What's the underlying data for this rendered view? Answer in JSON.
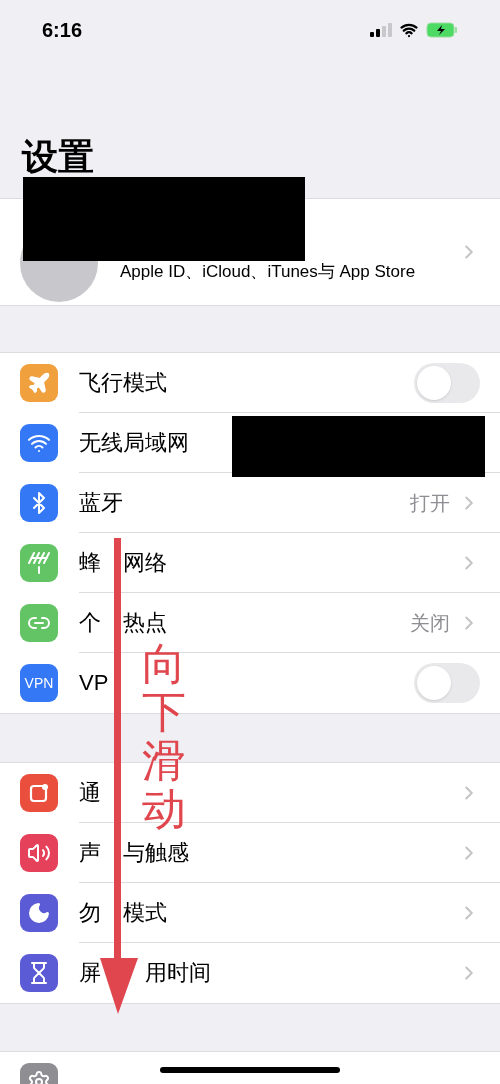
{
  "status_bar": {
    "time": "6:16"
  },
  "title": "设置",
  "profile": {
    "subtitle": "Apple ID、iCloud、iTunes与 App Store",
    "redacted": true
  },
  "groups": [
    {
      "rows": [
        {
          "kind": "toggle",
          "label_parts": [
            "飞行模式"
          ],
          "color": "#f0a03c",
          "on": false
        },
        {
          "kind": "link",
          "label_parts": [
            "无线局域网"
          ],
          "color": "#3478f6",
          "redacted": true
        },
        {
          "kind": "link",
          "label_parts": [
            "蓝牙"
          ],
          "color": "#3478f6",
          "detail": "打开"
        },
        {
          "kind": "link",
          "label_parts": [
            "蜂",
            "网络"
          ],
          "color": "#62c465"
        },
        {
          "kind": "link",
          "label_parts": [
            "个",
            "热点"
          ],
          "color": "#62c465",
          "detail": "关闭"
        },
        {
          "kind": "toggle",
          "label_parts": [
            "VP"
          ],
          "color": "#3478f6",
          "icon_text": "VPN",
          "on": false
        }
      ]
    },
    {
      "rows": [
        {
          "kind": "link",
          "label_parts": [
            "通"
          ],
          "color": "#ea4e3d"
        },
        {
          "kind": "link",
          "label_parts": [
            "声",
            "与触感"
          ],
          "color": "#e6415a"
        },
        {
          "kind": "link",
          "label_parts": [
            "勿",
            "模式"
          ],
          "color": "#5b5bd6"
        },
        {
          "kind": "link",
          "label_parts": [
            "屏",
            "用时间"
          ],
          "color": "#5b5bd6"
        }
      ]
    },
    {
      "rows": [
        {
          "kind": "partial",
          "color": "#8e8e93"
        }
      ]
    }
  ],
  "annotation": {
    "text": "向下滑动"
  }
}
